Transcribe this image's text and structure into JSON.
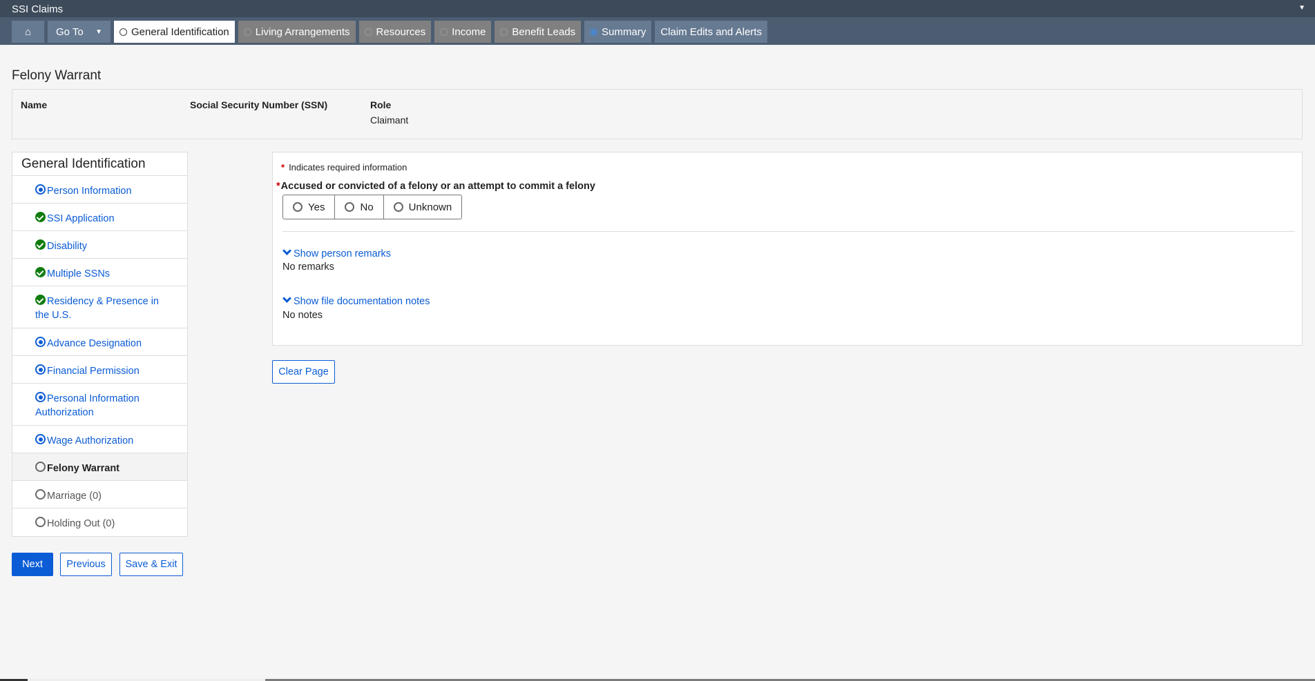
{
  "app": {
    "title": "SSI Claims"
  },
  "nav": {
    "home_icon": "home-icon",
    "goto": "Go To",
    "tabs": [
      {
        "label": "General Identification",
        "state": "active"
      },
      {
        "label": "Living Arrangements",
        "state": "disabled"
      },
      {
        "label": "Resources",
        "state": "disabled"
      },
      {
        "label": "Income",
        "state": "disabled"
      },
      {
        "label": "Benefit Leads",
        "state": "disabled"
      },
      {
        "label": "Summary",
        "state": "selected"
      },
      {
        "label": "Claim Edits and Alerts",
        "state": "none"
      }
    ]
  },
  "page": {
    "title": "Felony Warrant"
  },
  "info": {
    "name_label": "Name",
    "ssn_label": "Social Security Number (SSN)",
    "role_label": "Role",
    "role_value": "Claimant"
  },
  "sidebar": {
    "title": "General Identification",
    "items": [
      {
        "label": "Person Information",
        "status": "in-progress"
      },
      {
        "label": "SSI Application",
        "status": "complete"
      },
      {
        "label": "Disability",
        "status": "complete"
      },
      {
        "label": "Multiple SSNs",
        "status": "complete"
      },
      {
        "label": "Residency & Presence in the U.S.",
        "status": "complete"
      },
      {
        "label": "Advance Designation",
        "status": "in-progress"
      },
      {
        "label": "Financial Permission",
        "status": "in-progress"
      },
      {
        "label": "Personal Information Authorization",
        "status": "in-progress"
      },
      {
        "label": "Wage Authorization",
        "status": "in-progress"
      },
      {
        "label": "Felony Warrant",
        "status": "current"
      },
      {
        "label": "Marriage (0)",
        "status": "not-started"
      },
      {
        "label": "Holding Out (0)",
        "status": "not-started"
      }
    ]
  },
  "form": {
    "required_note": "Indicates required information",
    "question": "Accused or convicted of a felony or an attempt to commit a felony",
    "options": [
      "Yes",
      "No",
      "Unknown"
    ],
    "selected": null,
    "remarks_link": "Show person remarks",
    "remarks_text": "No remarks",
    "notes_link": "Show file documentation notes",
    "notes_text": "No notes",
    "clear": "Clear Page"
  },
  "actions": {
    "next": "Next",
    "previous": "Previous",
    "save_exit": "Save & Exit"
  },
  "colors": {
    "accent": "#0b5cd5",
    "complete": "#107c10",
    "header": "#3c4a5a",
    "nav": "#4c5d72"
  }
}
